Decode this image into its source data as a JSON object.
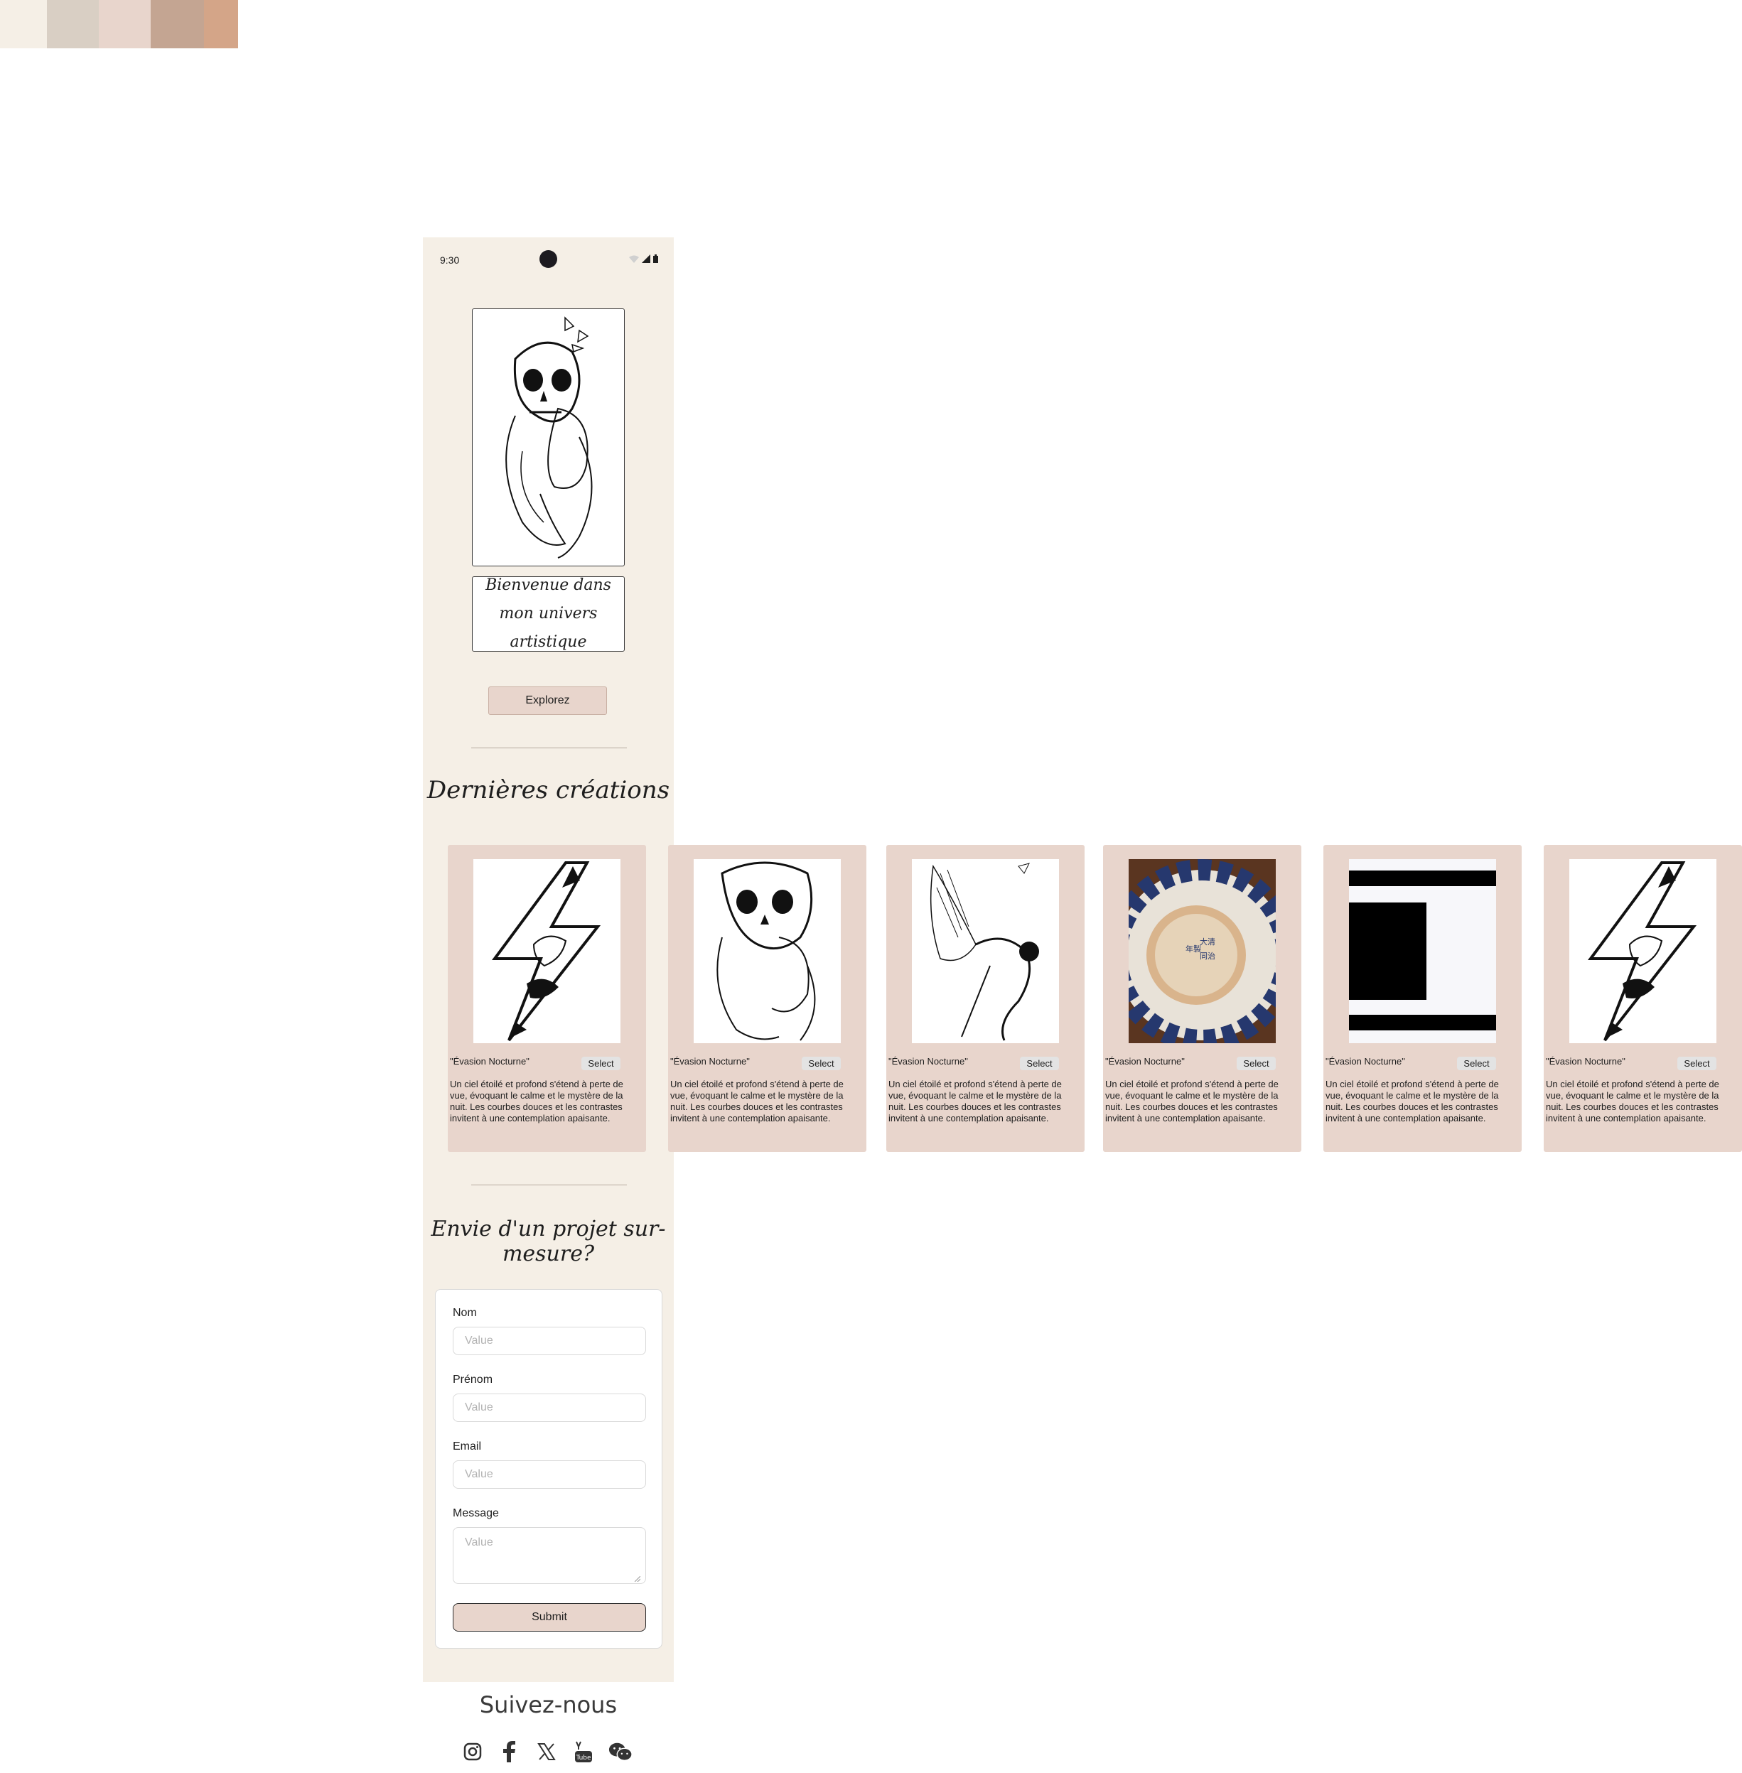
{
  "palette": [
    "#f5efe6",
    "#d9cfc4",
    "#e8d5cc",
    "#c4a592",
    "#d4a588"
  ],
  "status_bar": {
    "time": "9:30"
  },
  "hero": {
    "welcome_text": "Bienvenue dans mon univers artistique",
    "explore_label": "Explorez"
  },
  "latest": {
    "heading": "Dernières créations",
    "cards": [
      {
        "image": "lightning-face-drawing",
        "title": "\"Évasion Nocturne\"",
        "select_label": "Select",
        "description": "Un ciel étoilé et profond s'étend à perte de vue, évoquant le calme et le mystère de la nuit. Les courbes douces et les contrastes invitent à une contemplation apaisante."
      },
      {
        "image": "skull-woman-drawing",
        "title": "\"Évasion Nocturne\"",
        "select_label": "Select",
        "description": "Un ciel étoilé et profond s'étend à perte de vue, évoquant le calme et le mystère de la nuit. Les courbes douces et les contrastes invitent à une contemplation apaisante."
      },
      {
        "image": "winged-figure-drawing",
        "title": "\"Évasion Nocturne\"",
        "select_label": "Select",
        "description": "Un ciel étoilé et profond s'étend à perte de vue, évoquant le calme et le mystère de la nuit. Les courbes douces et les contrastes invitent à une contemplation apaisante."
      },
      {
        "image": "porcelain-bowl-photo",
        "title": "\"Évasion Nocturne\"",
        "select_label": "Select",
        "description": "Un ciel étoilé et profond s'étend à perte de vue, évoquant le calme et le mystère de la nuit. Les courbes douces et les contrastes invitent à une contemplation apaisante."
      },
      {
        "image": "black-bars-placeholder",
        "title": "\"Évasion Nocturne\"",
        "select_label": "Select",
        "description": "Un ciel étoilé et profond s'étend à perte de vue, évoquant le calme et le mystère de la nuit. Les courbes douces et les contrastes invitent à une contemplation apaisante."
      },
      {
        "image": "lightning-face-drawing",
        "title": "\"Évasion Nocturne\"",
        "select_label": "Select",
        "description": "Un ciel étoilé et profond s'étend à perte de vue, évoquant le calme et le mystère de la nuit. Les courbes douces et les contrastes invitent à une contemplation apaisante."
      }
    ]
  },
  "contact": {
    "heading": "Envie d'un projet sur-mesure?",
    "fields": {
      "nom": {
        "label": "Nom",
        "placeholder": "Value"
      },
      "prenom": {
        "label": "Prénom",
        "placeholder": "Value"
      },
      "email": {
        "label": "Email",
        "placeholder": "Value"
      },
      "message": {
        "label": "Message",
        "placeholder": "Value"
      }
    },
    "submit_label": "Submit"
  },
  "social": {
    "title": "Suivez-nous",
    "icons": [
      "instagram-icon",
      "facebook-icon",
      "x-icon",
      "youtube-icon",
      "wechat-icon"
    ]
  }
}
